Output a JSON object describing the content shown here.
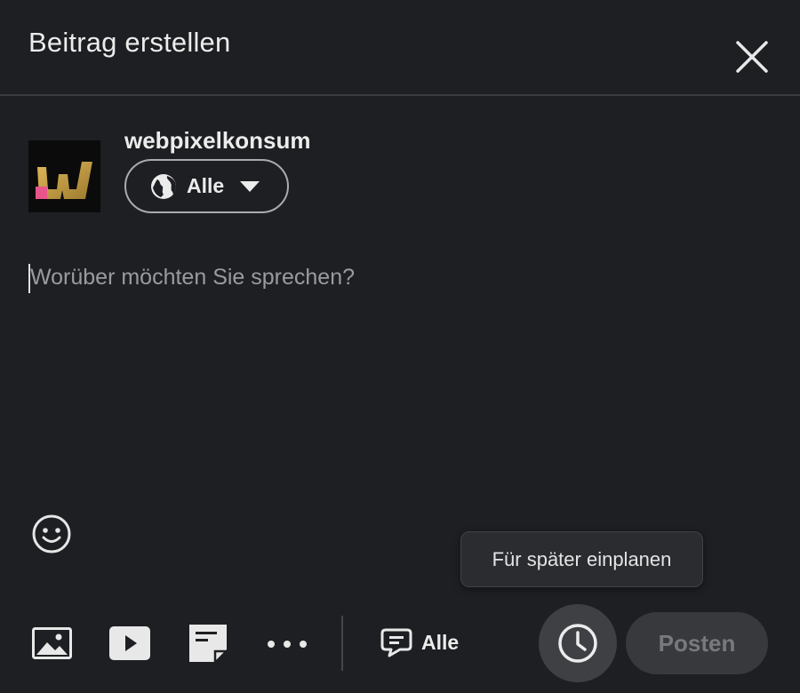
{
  "dialog": {
    "title": "Beitrag erstellen",
    "close_icon": "close-icon"
  },
  "author": {
    "name": "webpixelkonsum",
    "avatar_icon": "webpixelkonsum-logo",
    "audience_label": "Alle",
    "audience_icon": "globe-icon"
  },
  "editor": {
    "placeholder": "Worüber möchten Sie sprechen?"
  },
  "tooltip": {
    "text": "Für später einplanen"
  },
  "toolbar": {
    "media_icon": "image-icon",
    "video_icon": "video-icon",
    "document_icon": "document-icon",
    "more_icon": "more-icon",
    "comment_label": "Alle",
    "comment_icon": "comment-icon",
    "schedule_icon": "clock-icon",
    "post_label": "Posten"
  },
  "colors": {
    "background": "#1d1f22",
    "tooltip_bg": "#2a2c30",
    "post_disabled_bg": "#37393d",
    "post_disabled_text": "#77797d",
    "logo_gold": "#c9a24a",
    "logo_pink": "#e8558a"
  }
}
